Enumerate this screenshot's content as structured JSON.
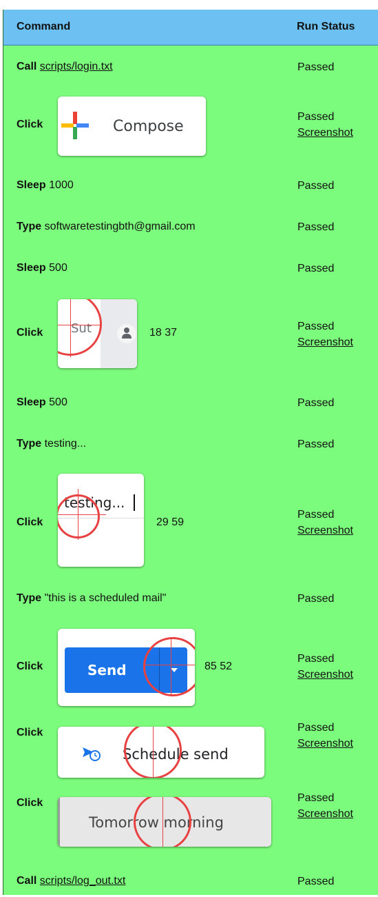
{
  "headers": {
    "command": "Command",
    "run_status": "Run Status"
  },
  "rows": [
    {
      "kw": "Call",
      "arg": "scripts/login.txt",
      "status": "Passed"
    },
    {
      "kw": "Click",
      "thumb_label": "Compose",
      "status": "Passed",
      "screenshot": "Screenshot"
    },
    {
      "kw": "Sleep",
      "arg": "1000",
      "status": "Passed"
    },
    {
      "kw": "Type",
      "arg": "softwaretestingbth@gmail.com",
      "status": "Passed"
    },
    {
      "kw": "Sleep",
      "arg": "500",
      "status": "Passed"
    },
    {
      "kw": "Click",
      "thumb_label": "Sut",
      "coords": "18 37",
      "status": "Passed",
      "screenshot": "Screenshot"
    },
    {
      "kw": "Sleep",
      "arg": "500",
      "status": "Passed"
    },
    {
      "kw": "Type",
      "arg": "testing...",
      "status": "Passed"
    },
    {
      "kw": "Click",
      "thumb_label": "testing...",
      "coords": "29 59",
      "status": "Passed",
      "screenshot": "Screenshot"
    },
    {
      "kw": "Type",
      "arg": "\"this is a scheduled mail\"",
      "status": "Passed"
    },
    {
      "kw": "Click",
      "thumb_label": "Send",
      "coords": "85 52",
      "status": "Passed",
      "screenshot": "Screenshot"
    },
    {
      "kw": "Click",
      "thumb_label": "Schedule send",
      "status": "Passed",
      "screenshot": "Screenshot"
    },
    {
      "kw": "Click",
      "thumb_label": "Tomorrow morning",
      "status": "Passed",
      "screenshot": "Screenshot"
    },
    {
      "kw": "Call",
      "arg": "scripts/log_out.txt",
      "status": "Passed"
    }
  ],
  "colors": {
    "header_bg": "#6cc0f2",
    "table_bg": "#7cfc7c",
    "marker": "#e84141",
    "send_blue": "#1a73e8"
  }
}
